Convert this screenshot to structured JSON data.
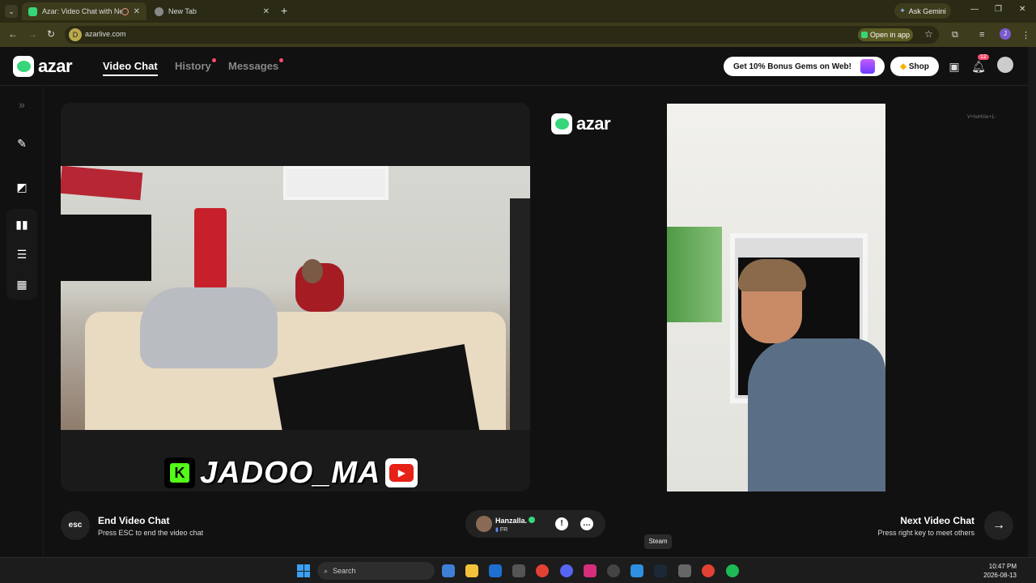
{
  "browser": {
    "tabs": [
      {
        "title": "Azar: Video Chat with New",
        "close": "✕"
      },
      {
        "title": "New Tab",
        "close": "✕"
      }
    ],
    "new_tab": "+",
    "gemini_label": "Ask Gemini",
    "window_controls": [
      "—",
      "❐",
      "✕"
    ],
    "url": "azarlive.com",
    "site_icon": "D",
    "open_in_app": "Open in app",
    "profile_initial": "J"
  },
  "header": {
    "logo": "azar",
    "nav": [
      {
        "label": "Video Chat",
        "active": true
      },
      {
        "label": "History",
        "dot": true
      },
      {
        "label": "Messages",
        "dot": true
      }
    ],
    "promo": "Get 10% Bonus Gems on Web!",
    "shop": "Shop",
    "notification_count": "12"
  },
  "overlay": {
    "streamer_name": "JADOO_MA",
    "kick_letter": "K"
  },
  "center_logo": "azar",
  "watermark": "V+hoHGe+1-",
  "controls": {
    "end_title": "End Video Chat",
    "end_sub": "Press ESC to end the video chat",
    "esc_label": "esc",
    "next_title": "Next Video Chat",
    "next_sub": "Press right key to meet others",
    "partner_name": "Hanzalla.",
    "partner_country": "FR"
  },
  "tooltip": "Steam",
  "taskbar": {
    "search": "Search",
    "time": "10:47 PM",
    "date": "2026-08-13"
  },
  "colors": {
    "brand_green": "#37d67a",
    "notification_red": "#ff4d6d"
  }
}
